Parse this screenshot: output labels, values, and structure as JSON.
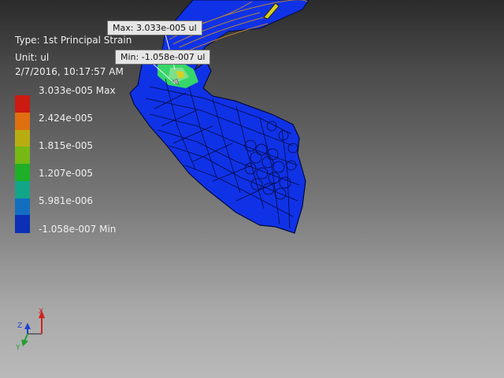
{
  "result": {
    "type_line": "Type: 1st Principal Strain",
    "unit_line": "Unit: ul",
    "date_line": "2/7/2016, 10:17:57 AM"
  },
  "legend": {
    "max_label": "3.033e-005 Max",
    "labels": [
      "2.424e-005",
      "1.815e-005",
      "1.207e-005",
      "5.981e-006"
    ],
    "min_label": "-1.058e-007 Min",
    "colors": [
      "#cc1a10",
      "#e06f12",
      "#b8ad10",
      "#76b814",
      "#1fae27",
      "#13a588",
      "#136ec0",
      "#0b2fb5"
    ]
  },
  "probes": {
    "max": "Max: 3.033e-005 ul",
    "min": "Min: -1.058e-007 ul"
  },
  "triad": {
    "x_label": "X",
    "y_label": "Y",
    "z_label": "Z"
  },
  "colors": {
    "model_blue": "#1032e6",
    "mesh_line": "#000a40",
    "hot_green": "#36d66a",
    "hot_yellow": "#d8d020"
  }
}
